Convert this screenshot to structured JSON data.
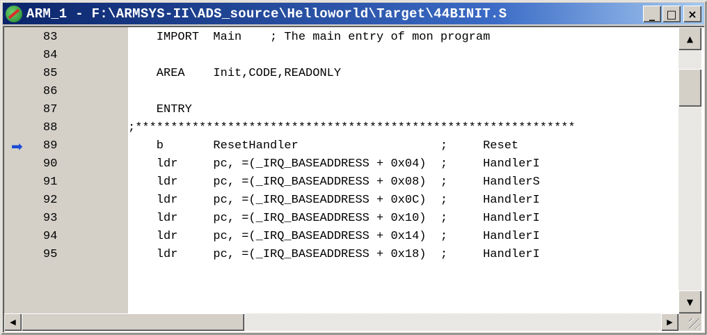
{
  "window": {
    "title": "ARM_1 - F:\\ARMSYS-II\\ADS_source\\Helloworld\\Target\\44BINIT.S",
    "buttons": {
      "minimize": "_",
      "maximize": "□",
      "close": "×"
    }
  },
  "editor": {
    "current_line_marker": "➡",
    "lines": [
      {
        "num": "83",
        "text": "    IMPORT  Main    ; The main entry of mon program"
      },
      {
        "num": "84",
        "text": ""
      },
      {
        "num": "85",
        "text": "    AREA    Init,CODE,READONLY"
      },
      {
        "num": "86",
        "text": ""
      },
      {
        "num": "87",
        "text": "    ENTRY"
      },
      {
        "num": "88",
        "text": ";**************************************************************"
      },
      {
        "num": "89",
        "text": "    b       ResetHandler                    ;     Reset"
      },
      {
        "num": "90",
        "text": "    ldr     pc, =(_IRQ_BASEADDRESS + 0x04)  ;     HandlerI"
      },
      {
        "num": "91",
        "text": "    ldr     pc, =(_IRQ_BASEADDRESS + 0x08)  ;     HandlerS"
      },
      {
        "num": "92",
        "text": "    ldr     pc, =(_IRQ_BASEADDRESS + 0x0C)  ;     HandlerI"
      },
      {
        "num": "93",
        "text": "    ldr     pc, =(_IRQ_BASEADDRESS + 0x10)  ;     HandlerI"
      },
      {
        "num": "94",
        "text": "    ldr     pc, =(_IRQ_BASEADDRESS + 0x14)  ;     HandlerI"
      },
      {
        "num": "95",
        "text": "    ldr     pc, =(_IRQ_BASEADDRESS + 0x18)  ;     HandlerI"
      }
    ],
    "current_line": "89"
  },
  "scrollbars": {
    "up_arrow": "▲",
    "down_arrow": "▼",
    "left_arrow": "◀",
    "right_arrow": "▶"
  }
}
